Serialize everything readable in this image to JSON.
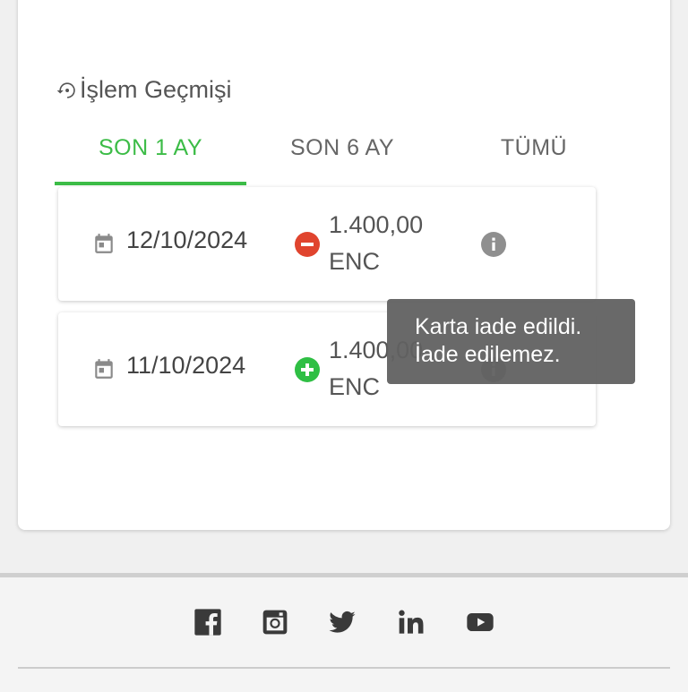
{
  "history": {
    "title": "İşlem Geçmişi",
    "title_icon": "history-icon"
  },
  "tabs": [
    {
      "label": "SON 1 AY",
      "active": true
    },
    {
      "label": "SON 6 AY",
      "active": false
    },
    {
      "label": "TÜMÜ",
      "active": false
    }
  ],
  "transactions": [
    {
      "date": "12/10/2024",
      "type": "debit",
      "amount": "1.400,00",
      "currency": "ENC",
      "status_icon": "minus-circle-icon",
      "info_icon": "info-icon"
    },
    {
      "date": "11/10/2024",
      "type": "credit",
      "amount": "1.400,00",
      "currency": "ENC",
      "status_icon": "plus-circle-icon",
      "info_icon": "info-icon"
    }
  ],
  "tooltip": {
    "line1": "Karta iade edildi.",
    "line2": "İade edilemez."
  },
  "footer": {
    "social_icons": [
      "facebook-icon",
      "instagram-icon",
      "twitter-icon",
      "linkedin-icon",
      "youtube-icon"
    ]
  },
  "colors": {
    "accent": "#3cbc47",
    "debit": "#e0442e",
    "credit": "#2fbf44",
    "tooltip_bg": "#616161"
  }
}
